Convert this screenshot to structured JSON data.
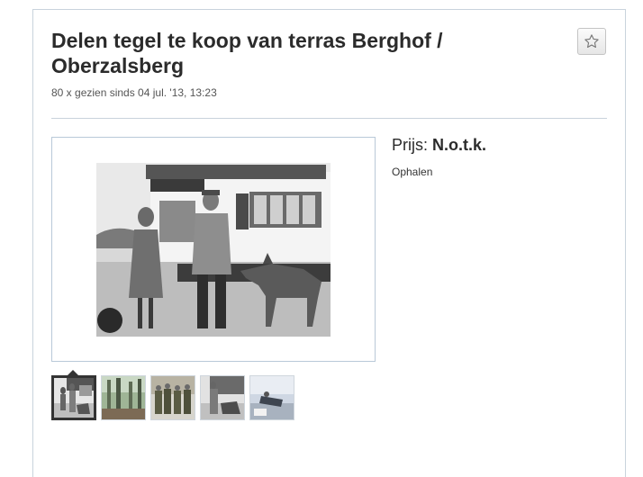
{
  "listing": {
    "title": "Delen tegel te koop van terras Berghof / Oberzalsberg",
    "meta": "80 x gezien sinds 04 jul. '13, 13:23",
    "price_label": "Prijs:",
    "price_value": "N.o.t.k.",
    "delivery": "Ophalen"
  },
  "icons": {
    "favorite": "star-outline-icon"
  },
  "photos": {
    "count": 5,
    "active_index": 0
  },
  "colors": {
    "border": "#c9d3dc",
    "photo_border": "#b9c9d8",
    "active_thumb": "#333333"
  }
}
